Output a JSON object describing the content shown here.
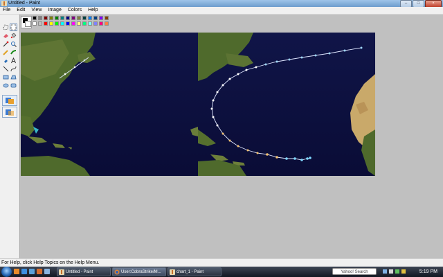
{
  "window": {
    "title": "Untitled - Paint"
  },
  "menu": [
    "File",
    "Edit",
    "View",
    "Image",
    "Colors",
    "Help"
  ],
  "palette": {
    "colors": [
      "#000000",
      "#808080",
      "#800000",
      "#808000",
      "#008000",
      "#008080",
      "#000080",
      "#800080",
      "#808040",
      "#004040",
      "#0080ff",
      "#004080",
      "#8000ff",
      "#804000",
      "#ffffff",
      "#c0c0c0",
      "#ff0000",
      "#ffff00",
      "#00ff00",
      "#00ffff",
      "#0000ff",
      "#ff00ff",
      "#ffff80",
      "#00ff80",
      "#80ffff",
      "#8080ff",
      "#ff0080",
      "#ff8040"
    ]
  },
  "status": {
    "help": "For Help, click Help Topics on the Help Menu."
  },
  "taskbar": {
    "tasks": [
      "Untitled - Paint",
      "User:CobraStrike/M...",
      "chart_1 - Paint"
    ],
    "search_label": "Yahoo! Search",
    "clock": "5:19 PM"
  },
  "colors": {
    "ocean": "#0b0d3a",
    "land": "#4f6a2c",
    "sand": "#c9a96a",
    "track_warm": "#f2c070",
    "track_cool": "#7fd8ff"
  }
}
